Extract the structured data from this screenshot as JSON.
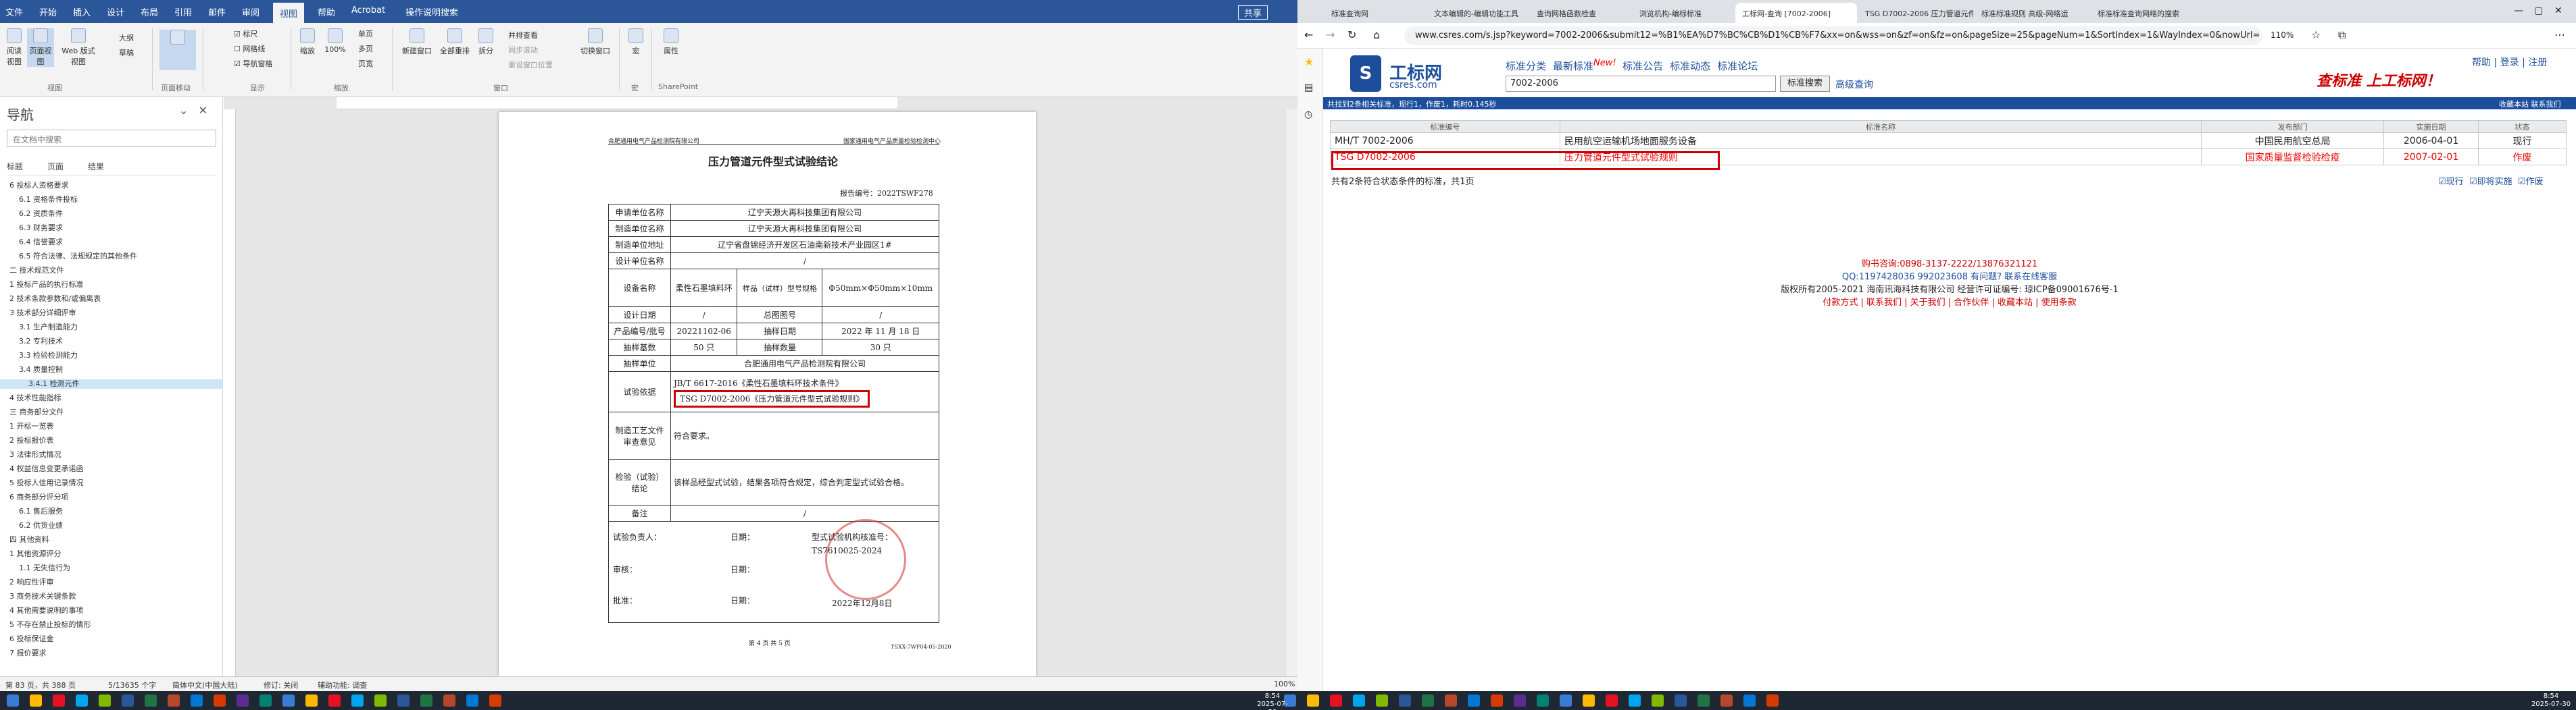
{
  "word": {
    "tabs": [
      "文件",
      "开始",
      "插入",
      "设计",
      "布局",
      "引用",
      "邮件",
      "审阅",
      "视图",
      "帮助",
      "Acrobat",
      "操作说明搜索"
    ],
    "share": "共享",
    "ribbon": {
      "buttons": [
        "阅读视图",
        "页面视图",
        "Web 版式视图",
        "大纲",
        "草稿",
        "标尺",
        "网格线",
        "导航窗格",
        "缩放",
        "100%",
        "单页",
        "多页",
        "页宽",
        "新建窗口",
        "全部重排",
        "拆分",
        "并排查看",
        "同步滚动",
        "重设窗口位置",
        "切换窗口",
        "宏",
        "属性"
      ],
      "groups": [
        "视图",
        "页面移动",
        "显示",
        "缩放",
        "窗口",
        "宏",
        "SharePoint"
      ]
    },
    "nav": {
      "title": "导航",
      "search_placeholder": "在文档中搜索",
      "tabs": [
        "标题",
        "页面",
        "结果"
      ],
      "items": [
        "6 投标人资格要求",
        "6.1 资格条件投标",
        "6.2 资质条件",
        "6.3 财务要求",
        "6.4 信誉要求",
        "6.5 符合法律、法规规定的其他条件",
        "二 技术规范文件",
        "1 投标产品的执行标准",
        "2 技术条款参数和/或偏离表",
        "3 技术部分详细评审",
        "3.1 生产制造能力",
        "3.2 专利技术",
        "3.3 检验检测能力",
        "3.4 质量控制",
        "3.4.1 检测元件",
        "4 技术性能指标",
        "三 商务部分文件",
        "1 开标一览表",
        "2 投标报价表",
        "3 法律形式情况",
        "4 权益信息变更承诺函",
        "5 投标人信用记录情况",
        "6 商务部分评分项",
        "6.1 售后服务",
        "6.2 供货业绩",
        "四 其他资料",
        "1 其他资源评分",
        "1.1 无失信行为",
        "2 响应性评审",
        "3 商务技术关键条款",
        "4 其他需要说明的事项",
        "5 不存在禁止投标的情形",
        "6 投标保证金",
        "7 报价要求"
      ],
      "selected_index": 14
    },
    "status": {
      "page": "第 83 页，共 388 页",
      "words": "5/13635 个字",
      "lang": "简体中文(中国大陆)",
      "track": "修订: 关闭",
      "a11y": "辅助功能: 调查",
      "zoom": "100%"
    },
    "doc": {
      "header_left": "合肥通用电气产品检测院有限公司",
      "header_right": "国家通用电气产品质量检验检测中心",
      "title": "压力管道元件型式试验结论",
      "report_no": "报告编号：2022TSWF278",
      "rows": [
        [
          "申请单位名称",
          "辽宁天源大再科技集团有限公司"
        ],
        [
          "制造单位名称",
          "辽宁天源大再科技集团有限公司"
        ],
        [
          "制造单位地址",
          "辽宁省盘锦经济开发区石油南新技术产业园区1#"
        ],
        [
          "设计单位名称",
          "/"
        ]
      ],
      "device": {
        "label": "设备名称",
        "name": "柔性石墨填料环",
        "spec_label": "样品（试样）型号规格",
        "spec": "Φ50mm×Φ50mm×10mm"
      },
      "row_design": [
        "设计日期",
        "/",
        "总图图号",
        "/"
      ],
      "row_product": [
        "产品编号/批号",
        "20221102-06",
        "抽样日期",
        "2022 年 11 月 18 日"
      ],
      "row_count": [
        "抽样基数",
        "50 只",
        "抽样数量",
        "30 只"
      ],
      "row_unit": [
        "抽样单位",
        "合肥通用电气产品检测院有限公司"
      ],
      "basis_label": "试验依据",
      "basis1": "JB/T 6617-2016《柔性石墨填料环技术条件》",
      "basis2": "TSG D7002-2006《压力管道元件型式试验规则》",
      "process_label": "制造工艺文件审查意见",
      "process_val": "符合要求。",
      "conclusion_label": "检验（试验）结论",
      "conclusion_val": "该样品经型式试验，结果各项符合规定，综合判定型式试验合格。",
      "remark_label": "备注",
      "remark_val": "/",
      "signers": [
        [
          "试验负责人：",
          "日期："
        ],
        [
          "审核：",
          "日期："
        ],
        [
          "批准：",
          "日期："
        ]
      ],
      "approval_no_label": "型式试验机构核准号：",
      "approval_no": "TS7610025-2024",
      "stamp_date": "2022年12月8日",
      "footer": "第 4 页 共 5 页",
      "code": "TSXX-7WF04-05-2020"
    }
  },
  "browser": {
    "tabs": [
      "标准查询网",
      "文本编辑的-编辑功能工具",
      "查询网格函数检查",
      "浏览机构-编标标准",
      "工标网-查询 [7002-2006]",
      "TSG D7002-2006 压力管道元件",
      "标准标准规则 高级-网络运",
      "标准标准查询网络的搜索"
    ],
    "active_tab": 4,
    "url": "www.csres.com/s.jsp?keyword=7002-2006&submit12=%B1%EA%D7%BC%CB%D1%CB%F7&xx=on&wss=on&zf=on&fz=on&pageSize=25&pageNum=1&SortIndex=1&WayIndex=0&nowUrl=",
    "zoom": "110%",
    "site": {
      "logo": "工标网",
      "domain": "csres.com",
      "nav": [
        "标准分类",
        "最新标准",
        "标准公告",
        "标准动态",
        "标准论坛"
      ],
      "new": "New!",
      "search_value": "7002-2006",
      "search_btn": "标准搜索",
      "advanced": "高级查询",
      "slogan": "查标准 上工标网！",
      "toplinks": "帮助 | 登录 | 注册",
      "result_summary": "共找到2条相关标准，现行1，作废1，耗时0.145秒",
      "bar_right": "收藏本站  联系我们",
      "headers": [
        "标准编号",
        "标准名称",
        "发布部门",
        "实施日期",
        "状态"
      ],
      "results": [
        [
          "MH/T 7002-2006",
          "民用航空运输机场地面服务设备",
          "中国民用航空总局",
          "2006-04-01",
          "现行"
        ],
        [
          "TSG D7002-2006",
          "压力管道元件型式试验规则",
          "国家质量监督检验检疫",
          "2007-02-01",
          "作废"
        ]
      ],
      "footnote": "共有2条符合状态条件的标准，共1页",
      "filters": [
        "现行",
        "即将实施",
        "作废"
      ],
      "purchase": "购书咨询:0898-3137-2222/13876321121",
      "qq": "QQ:1197428036 992023608 有问题? 联系在线客服",
      "copyright": "版权所有2005-2021 海南讯海科技有限公司 经营许可证编号: 琼ICP备09001676号-1",
      "links": "付款方式 | 联系我们 | 关于我们 | 合作伙伴 | 收藏本站 | 使用条款"
    }
  },
  "taskbar": {
    "time1": "8:54",
    "date1": "2025-07-30",
    "time2": "8:54",
    "date2": "2025-07-30"
  }
}
